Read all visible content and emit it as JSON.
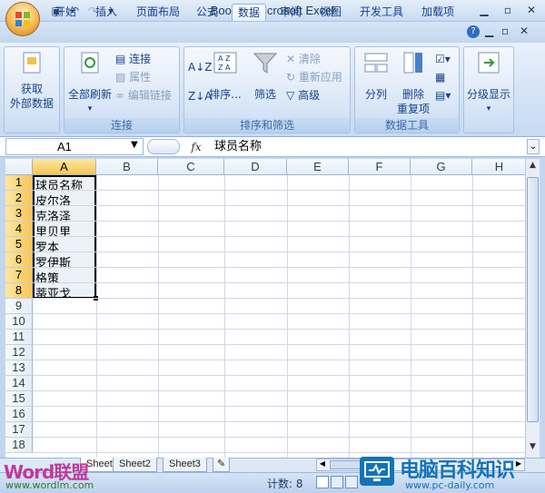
{
  "app": {
    "title": "Book1 - Microsoft Excel"
  },
  "qat": {
    "save_icon": "save-icon",
    "undo_icon": "undo-icon",
    "redo_icon": "redo-icon",
    "more_icon": "chevron-down-icon"
  },
  "tabs": [
    "开始",
    "插入",
    "页面布局",
    "公式",
    "数据",
    "审阅",
    "视图",
    "开发工具",
    "加载项"
  ],
  "active_tab": "数据",
  "ribbon": {
    "get_external": {
      "line1": "获取",
      "line2": "外部数据"
    },
    "refresh_all": "全部刷新",
    "connections": "连接",
    "properties": "属性",
    "edit_links": "编辑链接",
    "group_connections": "连接",
    "sort": "排序...",
    "filter": "筛选",
    "clear": "清除",
    "reapply": "重新应用",
    "advanced": "高级",
    "group_sort_filter": "排序和筛选",
    "text_to_columns": "分列",
    "remove_dup_line1": "删除",
    "remove_dup_line2": "重复项",
    "group_data_tools": "数据工具",
    "outline": "分级显示"
  },
  "formula_bar": {
    "name_box": "A1",
    "fx": "fx",
    "content": "球员名称"
  },
  "sheet": {
    "columns": [
      "A",
      "B",
      "C",
      "D",
      "E",
      "F",
      "G",
      "H"
    ],
    "rows": [
      "1",
      "2",
      "3",
      "4",
      "5",
      "6",
      "7",
      "8",
      "9",
      "10",
      "11",
      "12",
      "13",
      "14",
      "15",
      "16",
      "17",
      "18"
    ],
    "cells_a": [
      "球员名称",
      "皮尔洛",
      "克洛泽",
      "里贝里",
      "罗本",
      "罗伊斯",
      "格策",
      "蒂亚戈"
    ]
  },
  "sheet_tabs": [
    "Sheet1",
    "Sheet2",
    "Sheet3"
  ],
  "status": {
    "count": "计数: 8"
  },
  "watermarks": {
    "left_logo": "Word联盟",
    "left_url": "www.wordlm.com",
    "right_logo": "电脑百科知识",
    "right_url": "www.pc-daily.com"
  },
  "colors": {
    "ribbon_blue": "#c3d6ee",
    "selection": "#f8c454",
    "brand_blue": "#15428b"
  }
}
